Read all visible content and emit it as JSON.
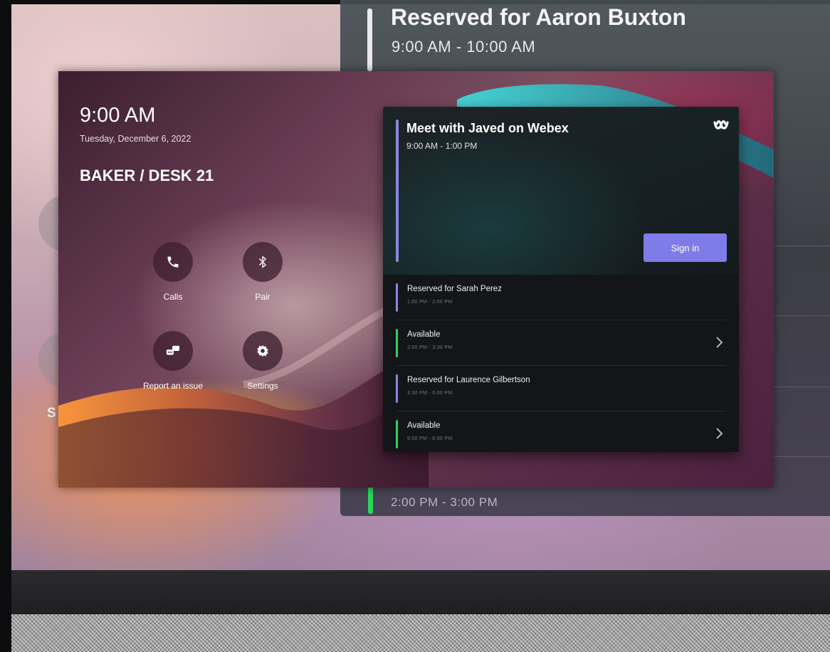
{
  "background": {
    "title": "Reserved for Aaron Buxton",
    "time": "9:00 AM - 10:00 AM",
    "bottom_time": "2:00 PM - 3:00 PM",
    "partial_letter": "S"
  },
  "home": {
    "clock": "9:00 AM",
    "date": "Tuesday, December 6, 2022",
    "location": "BAKER / DESK 21",
    "actions": [
      {
        "label": "Calls",
        "icon": "phone-icon"
      },
      {
        "label": "Pair",
        "icon": "bluetooth-icon"
      },
      {
        "label": "Report an issue",
        "icon": "report-issue-icon"
      },
      {
        "label": "Settings",
        "icon": "gear-icon"
      }
    ]
  },
  "booking": {
    "current": {
      "title": "Meet with Javed on Webex",
      "time": "9:00 AM - 1:00 PM",
      "signin_label": "Sign in",
      "brand_icon": "webex-icon"
    },
    "slots": [
      {
        "title": "Reserved for Sarah Perez",
        "time": "1:00 PM - 2:00 PM",
        "status": "reserved"
      },
      {
        "title": "Available",
        "time": "2:00 PM - 3:30 PM",
        "status": "available"
      },
      {
        "title": "Reserved for Laurence Gilbertson",
        "time": "3:30 PM - 5:00 PM",
        "status": "reserved"
      },
      {
        "title": "Available",
        "time": "5:00 PM - 6:00 PM",
        "status": "available"
      }
    ]
  },
  "colors": {
    "accent": "#7e7ce8",
    "reserved_bar": "#8a87e4",
    "available_bar": "#2bd45a"
  }
}
